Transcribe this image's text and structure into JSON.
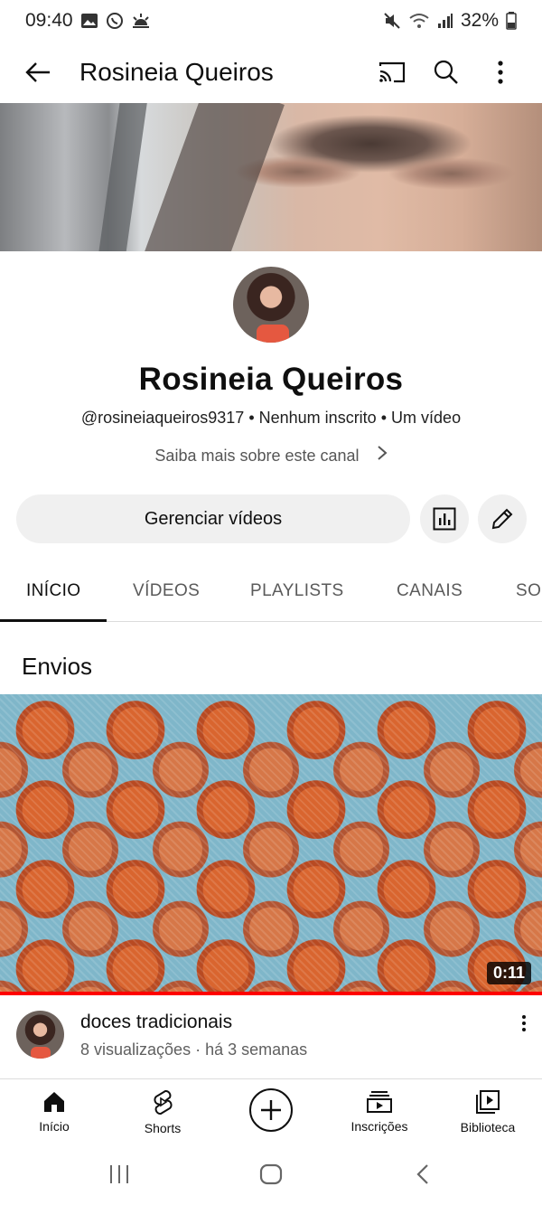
{
  "status_bar": {
    "time": "09:40",
    "battery": "32%",
    "icons_left": [
      "gallery-icon",
      "whatsapp-icon",
      "weather-icon"
    ],
    "icons_right": [
      "mute-icon",
      "wifi-icon",
      "signal-icon",
      "battery-icon"
    ]
  },
  "app_bar": {
    "title": "Rosineia Queiros",
    "icons": [
      "back-arrow-icon",
      "cast-icon",
      "search-icon",
      "more-vert-icon"
    ]
  },
  "channel": {
    "name": "Rosineia Queiros",
    "handle": "@rosineiaqueiros9317",
    "subscribers": "Nenhum inscrito",
    "videos": "Um vídeo",
    "separator": "•",
    "more_about": "Saiba mais sobre este canal"
  },
  "actions": {
    "manage_label": "Gerenciar vídeos",
    "analytics_icon": "analytics-icon",
    "edit_icon": "edit-pencil-icon"
  },
  "tabs": [
    {
      "label": "INÍCIO",
      "active": true
    },
    {
      "label": "VÍDEOS",
      "active": false
    },
    {
      "label": "PLAYLISTS",
      "active": false
    },
    {
      "label": "CANAIS",
      "active": false
    },
    {
      "label": "SO",
      "active": false
    }
  ],
  "section": {
    "title": "Envios"
  },
  "video": {
    "duration": "0:11",
    "title": "doces tradicionais",
    "views": "8 visualizações",
    "age": "há 3 semanas",
    "meta_sep": "·",
    "progress_color": "#ff0000"
  },
  "bottom_nav": [
    {
      "label": "Início",
      "icon": "home-icon"
    },
    {
      "label": "Shorts",
      "icon": "shorts-icon"
    },
    {
      "label": "",
      "icon": "create-plus-icon"
    },
    {
      "label": "Inscrições",
      "icon": "subscriptions-icon"
    },
    {
      "label": "Biblioteca",
      "icon": "library-icon"
    }
  ],
  "system_nav": [
    "recents-icon",
    "home-circle-icon",
    "back-chevron-icon"
  ]
}
